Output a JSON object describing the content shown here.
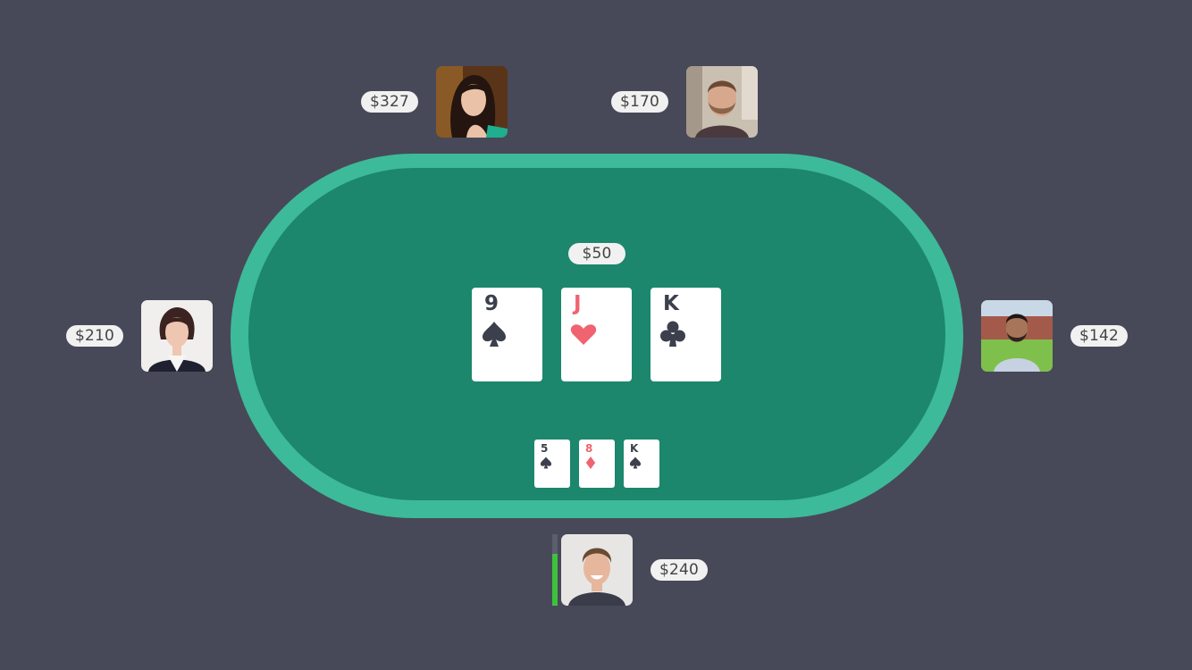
{
  "table": {
    "felt_color": "#1c876d",
    "rail_color": "#3dba99",
    "background_color": "#474958"
  },
  "pot": {
    "amount": "$50"
  },
  "community_cards": [
    {
      "rank": "9",
      "suit": "spade",
      "color": "dark"
    },
    {
      "rank": "J",
      "suit": "heart",
      "color": "red"
    },
    {
      "rank": "K",
      "suit": "club",
      "color": "dark"
    }
  ],
  "hand_cards": [
    {
      "rank": "5",
      "suit": "spade",
      "color": "dark"
    },
    {
      "rank": "8",
      "suit": "diamond",
      "color": "red"
    },
    {
      "rank": "K",
      "suit": "spade",
      "color": "dark"
    }
  ],
  "players": {
    "top_left": {
      "stack": "$327",
      "avatar": "woman-long-dark-hair"
    },
    "top_right": {
      "stack": "$170",
      "avatar": "man-beard"
    },
    "left": {
      "stack": "$210",
      "avatar": "woman-dark-hair-blazer"
    },
    "right": {
      "stack": "$142",
      "avatar": "man-outdoor"
    },
    "hero": {
      "stack": "$240",
      "avatar": "man-smiling",
      "turn_timer_remaining": 0.72
    }
  }
}
